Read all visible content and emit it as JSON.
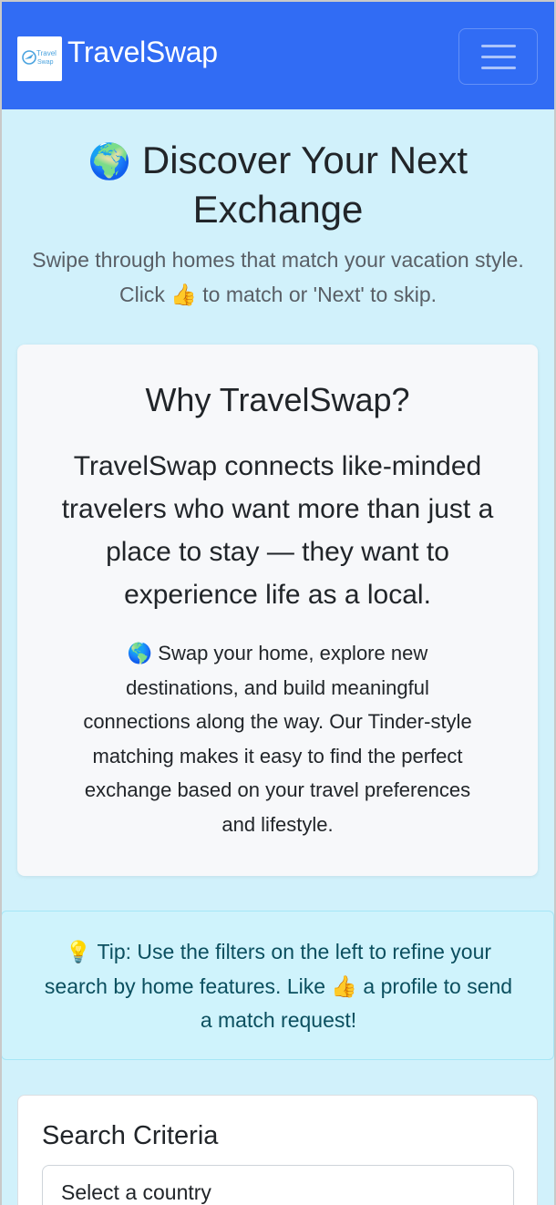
{
  "navbar": {
    "brand": "TravelSwap",
    "logo_text_line1": "Travel",
    "logo_text_line2": "Swap",
    "menu_icon": "hamburger-menu-icon",
    "color": "#316cf4"
  },
  "hero": {
    "globe_icon": "🌍",
    "title_line1": "Discover Your Next",
    "title_line2": "Exchange",
    "subtitle_line1": "Swipe through homes that match your vacation style.",
    "subtitle_line2_a": "Click",
    "thumbs_icon": "👍",
    "subtitle_line2_b": "to match or 'Next' to skip."
  },
  "why": {
    "title": "Why TravelSwap?",
    "lead_lines": [
      "TravelSwap connects like-minded",
      "travelers who want more than just a",
      "place to stay — they want to",
      "experience life as a local."
    ],
    "body_lines": [
      "🌎 Swap your home, explore new",
      "destinations, and build meaningful",
      "connections along the way. Our Tinder-style",
      "matching makes it easy to find the perfect",
      "exchange based on your travel preferences",
      "and lifestyle."
    ]
  },
  "tip": {
    "lines": [
      "💡 Tip: Use the filters on the left to refine your",
      "search by home features. Like 👍 a profile to send",
      "a match request!"
    ],
    "color": "#0b4f5f"
  },
  "search": {
    "title": "Search Criteria",
    "country_select_value": "Select a country"
  }
}
